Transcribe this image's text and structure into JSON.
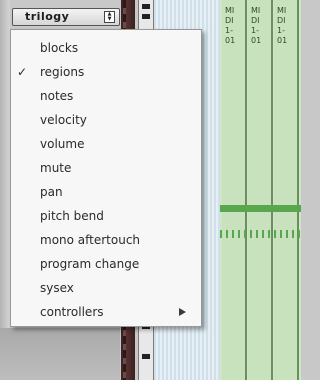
{
  "selector": {
    "label": "trilogy"
  },
  "menu": {
    "items": [
      {
        "label": "blocks",
        "checked": false
      },
      {
        "label": "regions",
        "checked": true
      },
      {
        "label": "notes",
        "checked": false
      },
      {
        "label": "velocity",
        "checked": false
      },
      {
        "label": "volume",
        "checked": false
      },
      {
        "label": "mute",
        "checked": false
      },
      {
        "label": "pan",
        "checked": false
      },
      {
        "label": "pitch bend",
        "checked": false
      },
      {
        "label": "mono aftertouch",
        "checked": false
      },
      {
        "label": "program change",
        "checked": false
      },
      {
        "label": "sysex",
        "checked": false
      },
      {
        "label": "controllers",
        "checked": false,
        "has_submenu": true
      }
    ],
    "check_mark": "✓"
  },
  "regions": [
    {
      "name": "MI\nDI\n1-\n01"
    },
    {
      "name": "MI\nDI\n1-\n01"
    },
    {
      "name": "MI\nDI\n1-\n01"
    }
  ],
  "colors": {
    "region_fill": "#c7e2bd",
    "midi_note": "#5aa64e",
    "menu_background": "#f7f7f7"
  }
}
